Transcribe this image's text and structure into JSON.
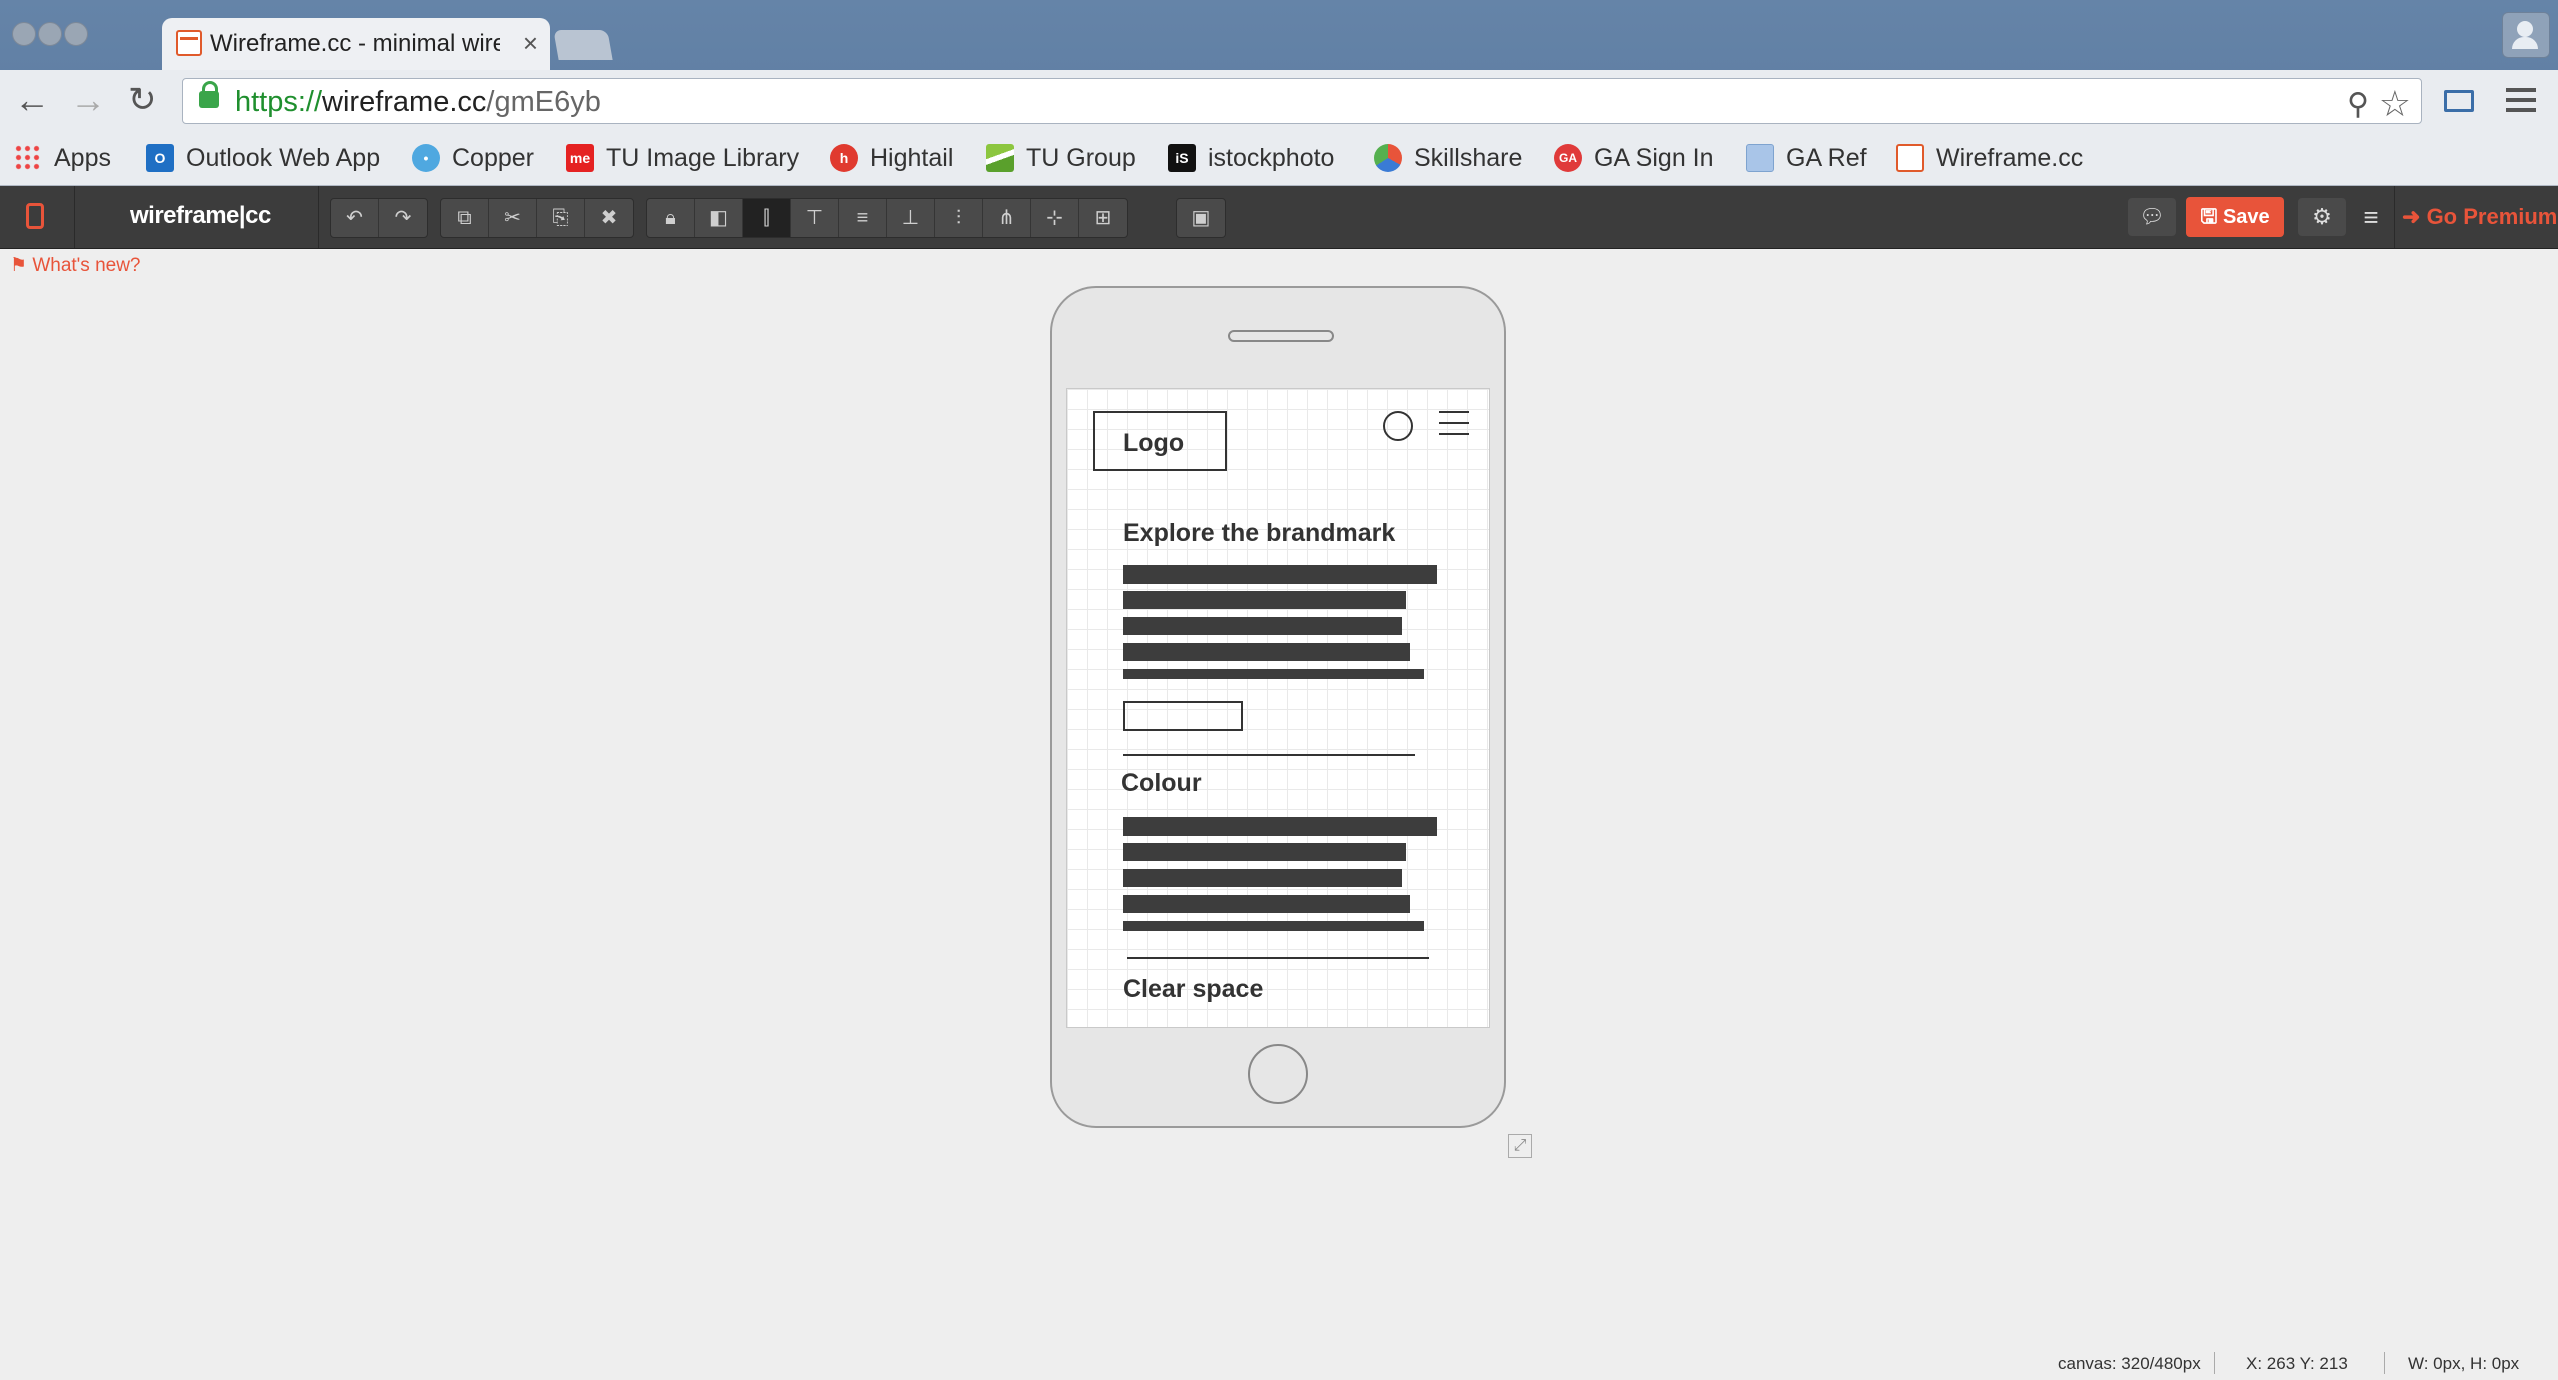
{
  "browser": {
    "tab_title": "Wireframe.cc - minimal wire",
    "tab_close": "×",
    "url": {
      "scheme": "https://",
      "host": "wireframe.cc",
      "path": "/gmE6yb"
    },
    "nav": {
      "back": "←",
      "forward": "→",
      "reload": "↻"
    },
    "zoom_glyph": "⚲",
    "star_glyph": "☆"
  },
  "bookmarks": [
    {
      "label": "Apps",
      "icon": "apps-grid-icon"
    },
    {
      "label": "Outlook Web App",
      "icon": "outlook-icon",
      "glyph": "O"
    },
    {
      "label": "Copper",
      "icon": "copper-icon",
      "glyph": "•"
    },
    {
      "label": "TU Image Library",
      "icon": "me-icon",
      "glyph": "me"
    },
    {
      "label": "Hightail",
      "icon": "hightail-icon",
      "glyph": "h"
    },
    {
      "label": "TU Group",
      "icon": "tu-group-icon",
      "glyph": ""
    },
    {
      "label": "istockphoto",
      "icon": "istock-icon",
      "glyph": "iS"
    },
    {
      "label": "Skillshare",
      "icon": "skillshare-icon",
      "glyph": ""
    },
    {
      "label": "GA Sign In",
      "icon": "ga-icon",
      "glyph": "GA"
    },
    {
      "label": "GA Ref",
      "icon": "folder-icon",
      "glyph": ""
    },
    {
      "label": "Wireframe.cc",
      "icon": "wireframe-favicon-icon",
      "glyph": ""
    }
  ],
  "app": {
    "logo": "wireframe|cc",
    "save_label": "Save",
    "premium_label": "Go Premium",
    "whats_new": "What's new?",
    "toolbar_glyphs": {
      "undo": "↶",
      "redo": "↷",
      "copy": "⧉",
      "cut": "✂",
      "paste": "⎘",
      "delete": "✖",
      "lock": "🔒︎",
      "arrange": "◧",
      "align_left": "⫿",
      "align_top": "⊤",
      "align_hleft": "≡",
      "align_bottom": "⊥",
      "align_right": "⫶",
      "align_vcenter": "⋔",
      "align_hcenter": "⊹",
      "distribute": "⊞",
      "group": "▣",
      "comment": "💬︎",
      "settings": "⚙",
      "menu": "≡",
      "premium_arrow": "➜",
      "save_icon": "🖫︎",
      "flag": "⚑"
    }
  },
  "wireframe": {
    "logo_label": "Logo",
    "section1_heading": "Explore the brandmark",
    "section2_heading": "Colour",
    "section3_heading": "Clear space"
  },
  "status": {
    "canvas": "canvas: 320/480px",
    "coords": "X: 263 Y: 213",
    "size": "W: 0px, H: 0px"
  },
  "colors": {
    "accent": "#e8543a",
    "toolbar_bg": "#3c3c3c",
    "canvas_bg": "#eeeeee",
    "chrome_blue": "#5b7aa0"
  }
}
